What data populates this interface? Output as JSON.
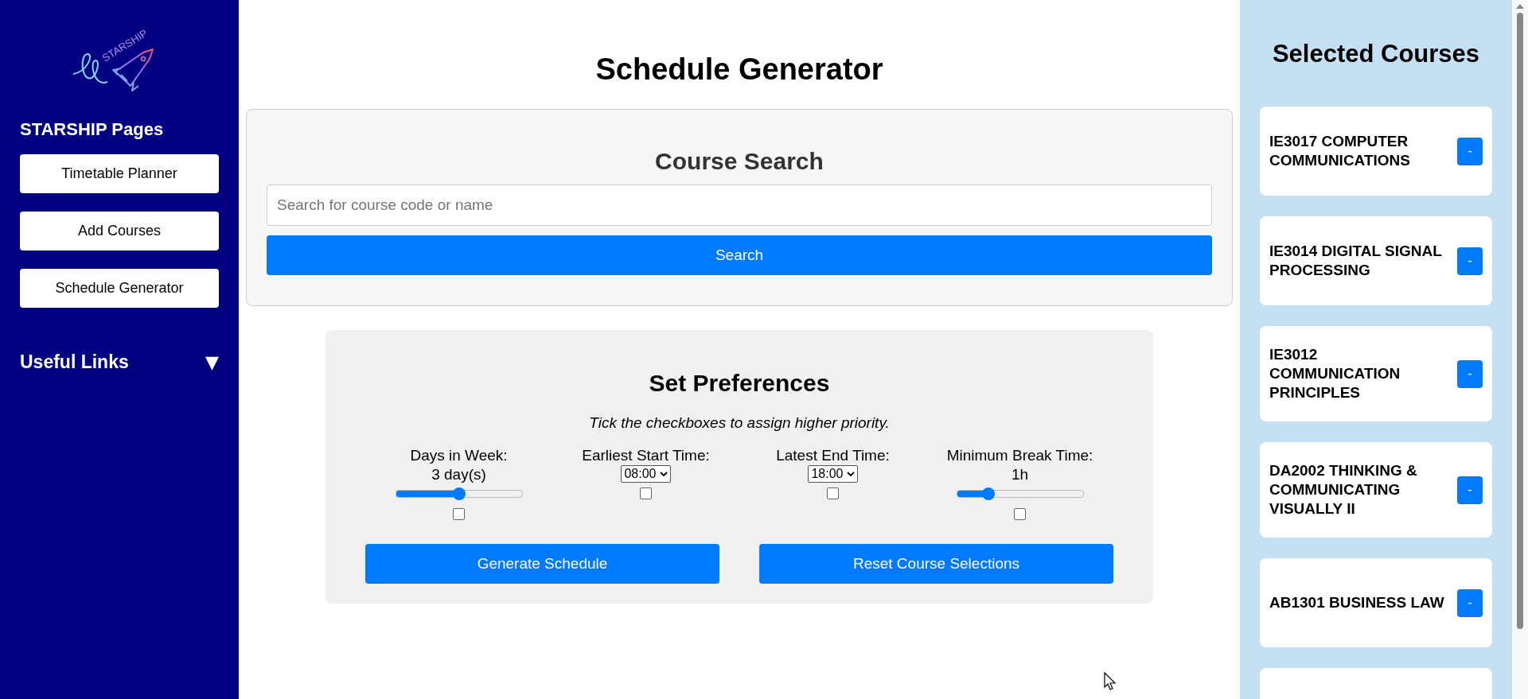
{
  "sidebar": {
    "logo_text": "STARSHIP",
    "heading": "STARSHIP Pages",
    "items": [
      {
        "label": "Timetable Planner"
      },
      {
        "label": "Add Courses"
      },
      {
        "label": "Schedule Generator"
      }
    ],
    "links": {
      "label": "Useful Links",
      "toggle": "▼",
      "expanded": false
    }
  },
  "page_title": "Schedule Generator",
  "search": {
    "title": "Course Search",
    "placeholder": "Search for course code or name",
    "button": "Search"
  },
  "preferences": {
    "title": "Set Preferences",
    "hint": "Tick the checkboxes to assign higher priority.",
    "items": [
      {
        "kind": "slider",
        "label": "Days in Week:",
        "reading": "3 day(s)",
        "level": 0.5,
        "checked": false
      },
      {
        "kind": "select",
        "label": "Earliest Start Time:",
        "value": "08:00",
        "checked": false
      },
      {
        "kind": "select",
        "label": "Latest End Time:",
        "value": "18:00",
        "checked": false
      },
      {
        "kind": "slider",
        "label": "Minimum Break Time:",
        "reading": "1h",
        "level": 0.25,
        "checked": false
      }
    ],
    "buttons": [
      "Generate Schedule",
      "Reset Course Selections"
    ]
  },
  "selected": {
    "title": "Selected Courses",
    "courses": [
      {
        "name": "IE3017 COMPUTER COMMUNICATIONS",
        "button": "-"
      },
      {
        "name": "IE3014 DIGITAL SIGNAL PROCESSING",
        "button": "-"
      },
      {
        "name": "IE3012 COMMUNICATION PRINCIPLES",
        "button": "-"
      },
      {
        "name": "DA2002 THINKING & COMMUNICATING VISUALLY II",
        "button": "-"
      },
      {
        "name": "AB1301 BUSINESS LAW",
        "button": "-"
      }
    ],
    "more_below": true
  }
}
